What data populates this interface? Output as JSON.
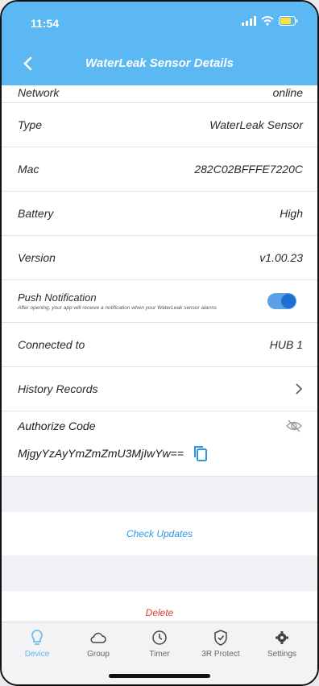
{
  "status_bar": {
    "time": "11:54"
  },
  "nav": {
    "title": "WaterLeak Sensor Details"
  },
  "rows": {
    "network": {
      "label": "Network",
      "value": "online"
    },
    "type": {
      "label": "Type",
      "value": "WaterLeak Sensor"
    },
    "mac": {
      "label": "Mac",
      "value": "282C02BFFFE7220C"
    },
    "battery": {
      "label": "Battery",
      "value": "High"
    },
    "version": {
      "label": "Version",
      "value": "v1.00.23"
    },
    "connected": {
      "label": "Connected to",
      "value": "HUB 1"
    },
    "history": {
      "label": "History Records"
    }
  },
  "push": {
    "title": "Push Notification",
    "desc": "After opening, your app will receive a notification when your WaterLeak sensor alarms",
    "enabled": true
  },
  "authorize": {
    "label": "Authorize Code",
    "code": "MjgyYzAyYmZmZmU3MjIwYw=="
  },
  "buttons": {
    "check_updates": "Check Updates",
    "delete": "Delete"
  },
  "tabs": [
    {
      "label": "Device",
      "icon": "bulb-icon",
      "active": true
    },
    {
      "label": "Group",
      "icon": "cloud-icon",
      "active": false
    },
    {
      "label": "Timer",
      "icon": "clock-icon",
      "active": false
    },
    {
      "label": "3R Protect",
      "icon": "shield-icon",
      "active": false
    },
    {
      "label": "Settings",
      "icon": "gear-icon",
      "active": false
    }
  ],
  "colors": {
    "header": "#5bb8f2",
    "accent": "#2b97e4",
    "danger": "#e03a33"
  }
}
